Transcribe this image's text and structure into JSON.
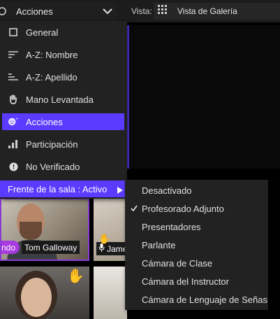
{
  "topbar": {
    "sort_label": "Acciones",
    "vista_label": "Vista:",
    "view_label": "Vista de Galería"
  },
  "sort_menu": {
    "items": [
      {
        "label": "General",
        "icon": "square-icon"
      },
      {
        "label": "A-Z: Nombre",
        "icon": "lines-icon"
      },
      {
        "label": "A-Z: Apellido",
        "icon": "lines-alt-icon"
      },
      {
        "label": "Mano Levantada",
        "icon": "raised-hand-icon"
      },
      {
        "label": "Acciones",
        "icon": "smiley-icon",
        "selected": true
      },
      {
        "label": "Participación",
        "icon": "bar-chart-icon"
      },
      {
        "label": "No Verificado",
        "icon": "alert-icon"
      }
    ],
    "front_row_label": "Frente de la sala : Activo"
  },
  "sub_menu": {
    "items": [
      {
        "label": "Desactivado",
        "checked": false
      },
      {
        "label": "Profesorado Adjunto",
        "checked": true
      },
      {
        "label": "Presentadores",
        "checked": false
      },
      {
        "label": "Parlante",
        "checked": false
      },
      {
        "label": "Cámara de Clase",
        "checked": false
      },
      {
        "label": "Cámara del Instructor",
        "checked": false
      },
      {
        "label": "Cámara de Lenguaje de Señas",
        "checked": false
      }
    ]
  },
  "tiles": {
    "tom_tag_partial": "ndo",
    "tom_name": "Tom Galloway",
    "james_name": "Jame"
  },
  "colors": {
    "accent": "#5b3bff",
    "tile_highlight": "#a83be0"
  }
}
